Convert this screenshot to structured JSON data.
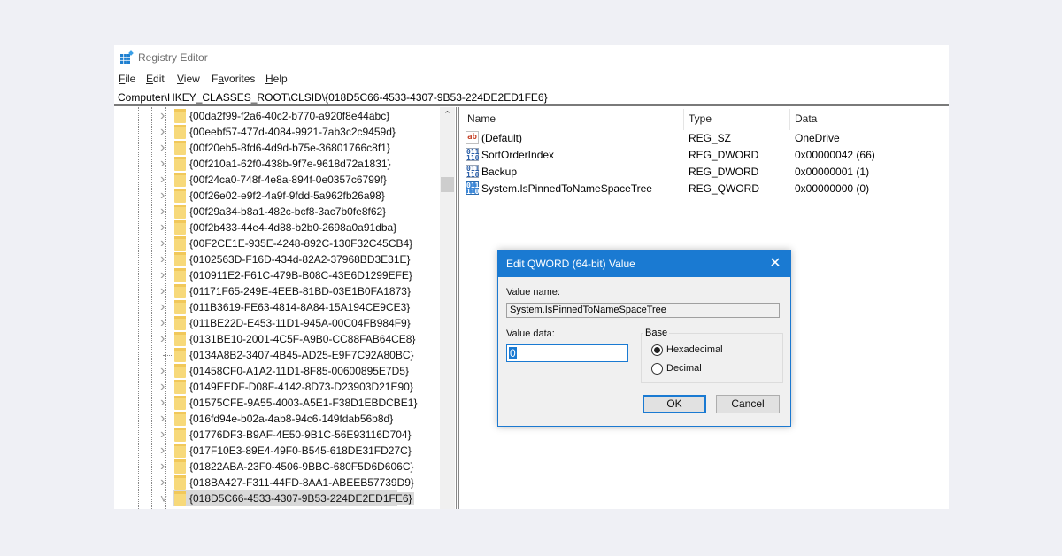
{
  "window": {
    "title": "Registry Editor",
    "icon": "registry-editor-icon"
  },
  "menu": [
    {
      "label": "File",
      "accel": "F",
      "rest": "ile"
    },
    {
      "label": "Edit",
      "accel": "E",
      "rest": "dit"
    },
    {
      "label": "View",
      "accel": "V",
      "rest": "iew"
    },
    {
      "label": "Favorites",
      "accel": "a",
      "pre": "F",
      "rest": "vorites"
    },
    {
      "label": "Help",
      "accel": "H",
      "rest": "elp"
    }
  ],
  "address": "Computer\\HKEY_CLASSES_ROOT\\CLSID\\{018D5C66-4533-4307-9B53-224DE2ED1FE6}",
  "tree": {
    "items": [
      {
        "label": "{00da2f99-f2a6-40c2-b770-a920f8e44abc}",
        "expander": "collapsed"
      },
      {
        "label": "{00eebf57-477d-4084-9921-7ab3c2c9459d}",
        "expander": "collapsed"
      },
      {
        "label": "{00f20eb5-8fd6-4d9d-b75e-36801766c8f1}",
        "expander": "collapsed"
      },
      {
        "label": "{00f210a1-62f0-438b-9f7e-9618d72a1831}",
        "expander": "collapsed"
      },
      {
        "label": "{00f24ca0-748f-4e8a-894f-0e0357c6799f}",
        "expander": "collapsed"
      },
      {
        "label": "{00f26e02-e9f2-4a9f-9fdd-5a962fb26a98}",
        "expander": "collapsed"
      },
      {
        "label": "{00f29a34-b8a1-482c-bcf8-3ac7b0fe8f62}",
        "expander": "collapsed"
      },
      {
        "label": "{00f2b433-44e4-4d88-b2b0-2698a0a91dba}",
        "expander": "collapsed"
      },
      {
        "label": "{00F2CE1E-935E-4248-892C-130F32C45CB4}",
        "expander": "collapsed"
      },
      {
        "label": "{0102563D-F16D-434d-82A2-37968BD3E31E}",
        "expander": "collapsed"
      },
      {
        "label": "{010911E2-F61C-479B-B08C-43E6D1299EFE}",
        "expander": "collapsed"
      },
      {
        "label": "{01171F65-249E-4EEB-81BD-03E1B0FA1873}",
        "expander": "collapsed"
      },
      {
        "label": "{011B3619-FE63-4814-8A84-15A194CE9CE3}",
        "expander": "collapsed"
      },
      {
        "label": "{011BE22D-E453-11D1-945A-00C04FB984F9}",
        "expander": "collapsed"
      },
      {
        "label": "{0131BE10-2001-4C5F-A9B0-CC88FAB64CE8}",
        "expander": "collapsed"
      },
      {
        "label": "{0134A8B2-3407-4B45-AD25-E9F7C92A80BC}",
        "expander": "none"
      },
      {
        "label": "{01458CF0-A1A2-11D1-8F85-00600895E7D5}",
        "expander": "collapsed"
      },
      {
        "label": "{0149EEDF-D08F-4142-8D73-D23903D21E90}",
        "expander": "collapsed"
      },
      {
        "label": "{01575CFE-9A55-4003-A5E1-F38D1EBDCBE1}",
        "expander": "collapsed"
      },
      {
        "label": "{016fd94e-b02a-4ab8-94c6-149fdab56b8d}",
        "expander": "collapsed"
      },
      {
        "label": "{01776DF3-B9AF-4E50-9B1C-56E93116D704}",
        "expander": "collapsed"
      },
      {
        "label": "{017F10E3-89E4-49F0-B545-618DE31FD27C}",
        "expander": "collapsed"
      },
      {
        "label": "{01822ABA-23F0-4506-9BBC-680F5D6D606C}",
        "expander": "collapsed"
      },
      {
        "label": "{018BA427-F311-44FD-8AA1-ABEEB57739D9}",
        "expander": "collapsed"
      },
      {
        "label": "{018D5C66-4533-4307-9B53-224DE2ED1FE6}",
        "expander": "expanded",
        "selected": true
      }
    ]
  },
  "values": {
    "columns": [
      "Name",
      "Type",
      "Data"
    ],
    "rows": [
      {
        "icon": "string-value-icon",
        "kind": "str",
        "glyph": "ab",
        "name": "(Default)",
        "type": "REG_SZ",
        "data": "OneDrive"
      },
      {
        "icon": "binary-value-icon",
        "kind": "dw",
        "glyph": "011\n110",
        "name": "SortOrderIndex",
        "type": "REG_DWORD",
        "data": "0x00000042 (66)"
      },
      {
        "icon": "binary-value-icon",
        "kind": "dw",
        "glyph": "011\n110",
        "name": "Backup",
        "type": "REG_DWORD",
        "data": "0x00000001 (1)"
      },
      {
        "icon": "binary-value-icon",
        "kind": "q",
        "glyph": "011\n110",
        "name": "System.IsPinnedToNameSpaceTree",
        "type": "REG_QWORD",
        "data": "0x00000000 (0)",
        "selected": true
      }
    ]
  },
  "dialog": {
    "title": "Edit QWORD (64-bit) Value",
    "value_name_label": "Value name:",
    "value_name": "System.IsPinnedToNameSpaceTree",
    "value_data_label": "Value data:",
    "value_data": "0",
    "base_label": "Base",
    "base_options": [
      {
        "label": "Hexadecimal",
        "checked": true
      },
      {
        "label": "Decimal",
        "checked": false
      }
    ],
    "ok_label": "OK",
    "cancel_label": "Cancel",
    "accent": "#1a7ad2"
  }
}
